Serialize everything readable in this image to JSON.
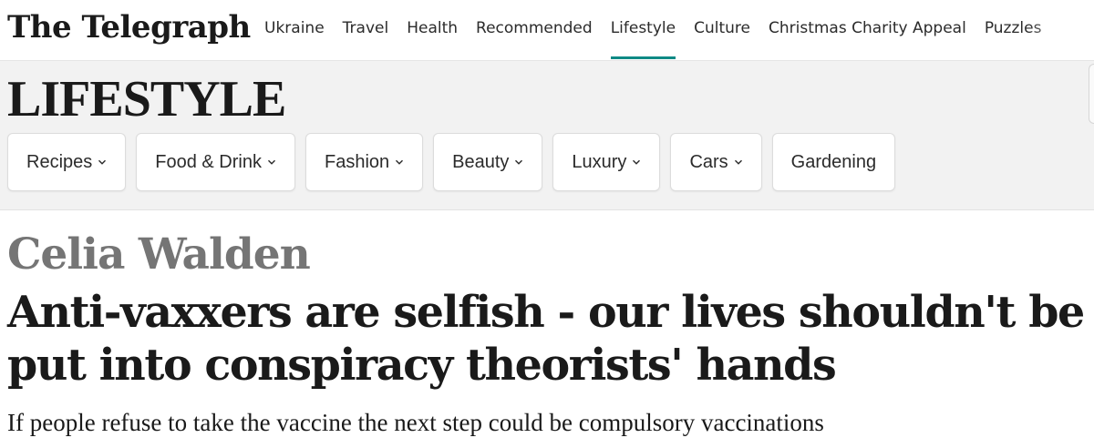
{
  "brand": {
    "logo_text": "The Telegraph"
  },
  "nav": {
    "items": [
      {
        "label": "Ukraine",
        "active": false
      },
      {
        "label": "Travel",
        "active": false
      },
      {
        "label": "Health",
        "active": false
      },
      {
        "label": "Recommended",
        "active": false
      },
      {
        "label": "Lifestyle",
        "active": true
      },
      {
        "label": "Culture",
        "active": false
      },
      {
        "label": "Christmas Charity Appeal",
        "active": false
      },
      {
        "label": "Puzzles",
        "active": false
      }
    ],
    "active_color": "#0f8a85"
  },
  "section": {
    "title": "LIFESTYLE",
    "subnav": [
      {
        "label": "Recipes",
        "has_dropdown": true
      },
      {
        "label": "Food & Drink",
        "has_dropdown": true
      },
      {
        "label": "Fashion",
        "has_dropdown": true
      },
      {
        "label": "Beauty",
        "has_dropdown": true
      },
      {
        "label": "Luxury",
        "has_dropdown": true
      },
      {
        "label": "Cars",
        "has_dropdown": true
      },
      {
        "label": "Gardening",
        "has_dropdown": false
      }
    ],
    "dropdown_icon": "chevron-down-icon"
  },
  "article": {
    "author": "Celia Walden",
    "headline": "Anti-vaxxers are selfish - our lives shouldn't be put into conspiracy theorists' hands",
    "standfirst": "If people refuse to take the vaccine the next step could be compulsory vaccinations"
  }
}
